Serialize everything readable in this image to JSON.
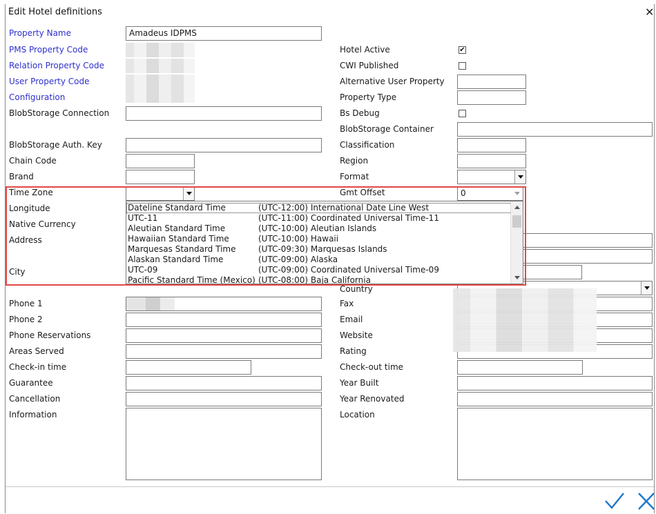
{
  "window": {
    "title": "Edit Hotel definitions"
  },
  "left": {
    "property_name": {
      "label": "Property Name",
      "value": "Amadeus IDPMS"
    },
    "pms_property_code": {
      "label": "PMS Property Code"
    },
    "relation_property_code": {
      "label": "Relation Property Code"
    },
    "user_property_code": {
      "label": "User Property Code"
    },
    "configuration": {
      "label": "Configuration"
    },
    "blob_connection": {
      "label": "BlobStorage Connection"
    },
    "blob_auth_key": {
      "label": "BlobStorage Auth. Key"
    },
    "chain_code": {
      "label": "Chain Code"
    },
    "brand": {
      "label": "Brand"
    },
    "time_zone": {
      "label": "Time Zone"
    },
    "longitude": {
      "label": "Longitude"
    },
    "native_currency": {
      "label": "Native Currency"
    },
    "address": {
      "label": "Address"
    },
    "city": {
      "label": "City"
    },
    "phone1": {
      "label": "Phone 1"
    },
    "phone2": {
      "label": "Phone 2"
    },
    "phone_reservations": {
      "label": "Phone Reservations"
    },
    "areas_served": {
      "label": "Areas Served"
    },
    "checkin_time": {
      "label": "Check-in time"
    },
    "guarantee": {
      "label": "Guarantee"
    },
    "cancellation": {
      "label": "Cancellation"
    },
    "information": {
      "label": "Information"
    }
  },
  "right": {
    "hotel_active": {
      "label": "Hotel Active",
      "checked": true,
      "mark": "✔"
    },
    "cwi_published": {
      "label": "CWI Published",
      "checked": false
    },
    "alt_user_property": {
      "label": "Alternative  User Property"
    },
    "property_type": {
      "label": "Property Type"
    },
    "bs_debug": {
      "label": "Bs Debug",
      "checked": false
    },
    "blob_container": {
      "label": "BlobStorage Container"
    },
    "classification": {
      "label": "Classification"
    },
    "region": {
      "label": "Region"
    },
    "format": {
      "label": "Format"
    },
    "gmt_offset": {
      "label": "Gmt Offset",
      "value": "0"
    },
    "country": {
      "label": "Country"
    },
    "fax": {
      "label": "Fax"
    },
    "email": {
      "label": "Email"
    },
    "website": {
      "label": "Website"
    },
    "rating": {
      "label": "Rating"
    },
    "checkout_time": {
      "label": "Check-out time"
    },
    "year_built": {
      "label": "Year Built"
    },
    "year_renovated": {
      "label": "Year Renovated"
    },
    "location": {
      "label": "Location"
    }
  },
  "timezone_list": [
    {
      "name": "Dateline Standard Time",
      "offset": "(UTC-12:00) International Date Line West"
    },
    {
      "name": "UTC-11",
      "offset": "(UTC-11:00) Coordinated Universal Time-11"
    },
    {
      "name": "Aleutian Standard Time",
      "offset": "(UTC-10:00) Aleutian Islands"
    },
    {
      "name": "Hawaiian Standard Time",
      "offset": "(UTC-10:00) Hawaii"
    },
    {
      "name": "Marquesas Standard Time",
      "offset": "(UTC-09:30) Marquesas Islands"
    },
    {
      "name": "Alaskan Standard Time",
      "offset": "(UTC-09:00) Alaska"
    },
    {
      "name": "UTC-09",
      "offset": "(UTC-09:00) Coordinated Universal Time-09"
    },
    {
      "name": "Pacific Standard Time (Mexico)",
      "offset": "(UTC-08:00) Baja California"
    }
  ],
  "colors": {
    "label_blue": "#2f2fcf",
    "highlight_red": "#e04848",
    "action_blue": "#1e78c8"
  },
  "icons": {
    "close": "close-icon",
    "ok": "checkmark-icon",
    "cancel": "cancel-x-icon"
  }
}
